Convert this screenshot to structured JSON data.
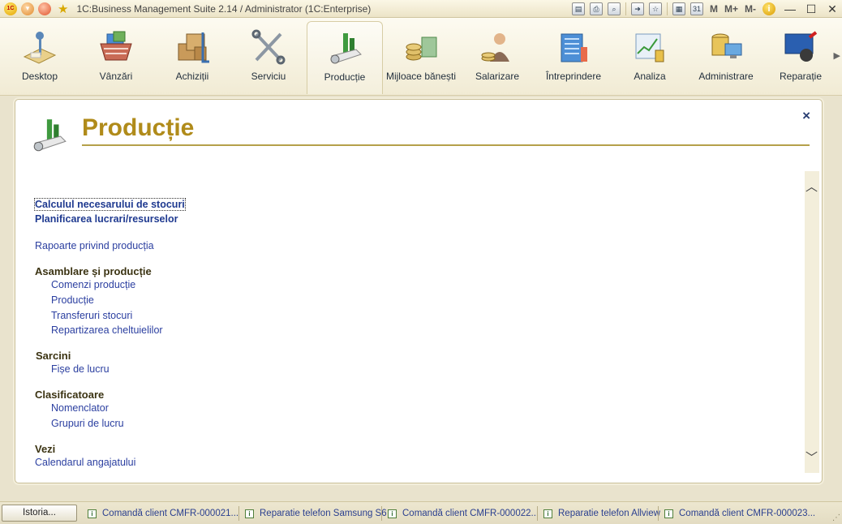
{
  "window": {
    "title": "1C:Business Management Suite 2.14 / Administrator  (1C:Enterprise)",
    "mem_buttons": [
      "M",
      "M+",
      "M-"
    ],
    "toolbar_icons": [
      "save-icon",
      "print-icon",
      "print-preview-icon",
      "go-to-icon",
      "favorites-icon",
      "calculator-icon",
      "calendar-icon",
      "info-icon"
    ],
    "calendar_day": "31",
    "info_glyph": "i",
    "minimize": "—",
    "maximize": "☐",
    "close": "✕"
  },
  "sections": [
    {
      "label": "Desktop",
      "icon": "desktop-icon"
    },
    {
      "label": "Vânzări",
      "icon": "sales-basket-icon"
    },
    {
      "label": "Achiziții",
      "icon": "purchases-boxes-icon"
    },
    {
      "label": "Serviciu",
      "icon": "service-tools-icon"
    },
    {
      "label": "Producție",
      "icon": "production-icon",
      "active": true
    },
    {
      "label": "Mijloace bănești",
      "icon": "money-icon"
    },
    {
      "label": "Salarizare",
      "icon": "payroll-icon"
    },
    {
      "label": "Întreprindere",
      "icon": "enterprise-icon"
    },
    {
      "label": "Analiza",
      "icon": "analysis-icon"
    },
    {
      "label": "Administrare",
      "icon": "administration-icon"
    },
    {
      "label": "Reparație",
      "icon": "repair-icon"
    }
  ],
  "form": {
    "title": "Producție",
    "close": "×",
    "links_top": [
      {
        "label": "Calculul necesarului de stocuri"
      },
      {
        "label": "Planificarea lucrari/resurselor"
      }
    ],
    "reports_link": "Rapoarte privind producția",
    "groups": [
      {
        "title": "Asamblare și producție",
        "items": [
          "Comenzi producție",
          "Producție",
          "Transferuri stocuri",
          "Repartizarea cheltuielilor"
        ]
      },
      {
        "title": "Sarcini",
        "items": [
          "Fișe de lucru"
        ]
      },
      {
        "title": "Clasificatoare",
        "items": [
          "Nomenclator",
          "Grupuri de lucru"
        ]
      },
      {
        "title": "Vezi",
        "items": [
          "Calendarul angajatului"
        ]
      }
    ]
  },
  "bottom": {
    "history_button": "Istoria...",
    "tasks": [
      "Comandă client CMFR-000021...",
      "Reparatie telefon Samsung S6",
      "Comandă client CMFR-000022...",
      "Reparatie telefon Allview",
      "Comandă client CMFR-000023..."
    ]
  }
}
